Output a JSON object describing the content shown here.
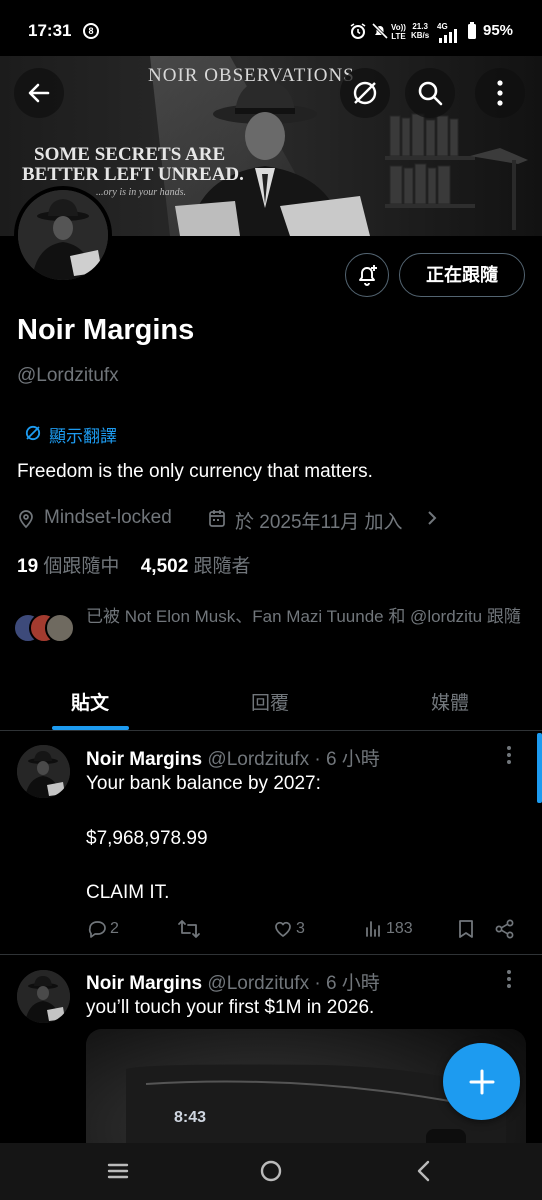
{
  "status_bar": {
    "time": "17:31",
    "notification_badge": "8",
    "network_speed_value": "21.3",
    "network_speed_unit": "KB/s",
    "volte_top": "Vo))",
    "volte_bottom": "LTE",
    "signal_type": "4G",
    "battery": "95%"
  },
  "banner": {
    "title": "NOIR OBSERVATIONS",
    "tagline_line1": "SOME SECRETS ARE",
    "tagline_line2": "BETTER LEFT UNREAD.",
    "subtitle": "...ory is in your hands."
  },
  "profile": {
    "name": "Noir Margins",
    "handle": "@Lordzitufx",
    "translate_label": "顯示翻譯",
    "bio": "Freedom is the only currency that matters.",
    "location": "Mindset-locked",
    "joined": "於 2025年11月 加入",
    "following_count": "19",
    "following_label": "個跟隨中",
    "followers_count": "4,502",
    "followers_label": "跟隨者",
    "followed_by": "已被 Not Elon Musk、Fan Mazi Tuunde 和 @lordzitu 跟隨"
  },
  "buttons": {
    "follow_state": "正在跟隨"
  },
  "tabs": [
    {
      "label": "貼文",
      "active": true
    },
    {
      "label": "回覆",
      "active": false
    },
    {
      "label": "媒體",
      "active": false
    }
  ],
  "tweets": [
    {
      "author": "Noir Margins",
      "handle": "@Lordzitufx",
      "time": "· 6 小時",
      "lines": [
        "Your bank balance by 2027:",
        "$7,968,978.99",
        "CLAIM IT."
      ],
      "replies": "2",
      "retweets": "",
      "likes": "3",
      "views": "183"
    },
    {
      "author": "Noir Margins",
      "handle": "@Lordzitufx",
      "time": "· 6 小時",
      "lines": [
        "you’ll touch your first $1M in 2026."
      ],
      "media_text": "8:43"
    }
  ],
  "icons": {
    "back": "arrow-left-icon",
    "translate": "translate-icon",
    "search": "search-icon",
    "more": "more-vertical-icon",
    "bell": "bell-plus-icon",
    "location": "location-pin-icon",
    "calendar": "calendar-icon",
    "compose": "plus-icon"
  },
  "colors": {
    "accent": "#1d9bf0",
    "background": "#000000",
    "secondary_text": "#71767b"
  }
}
